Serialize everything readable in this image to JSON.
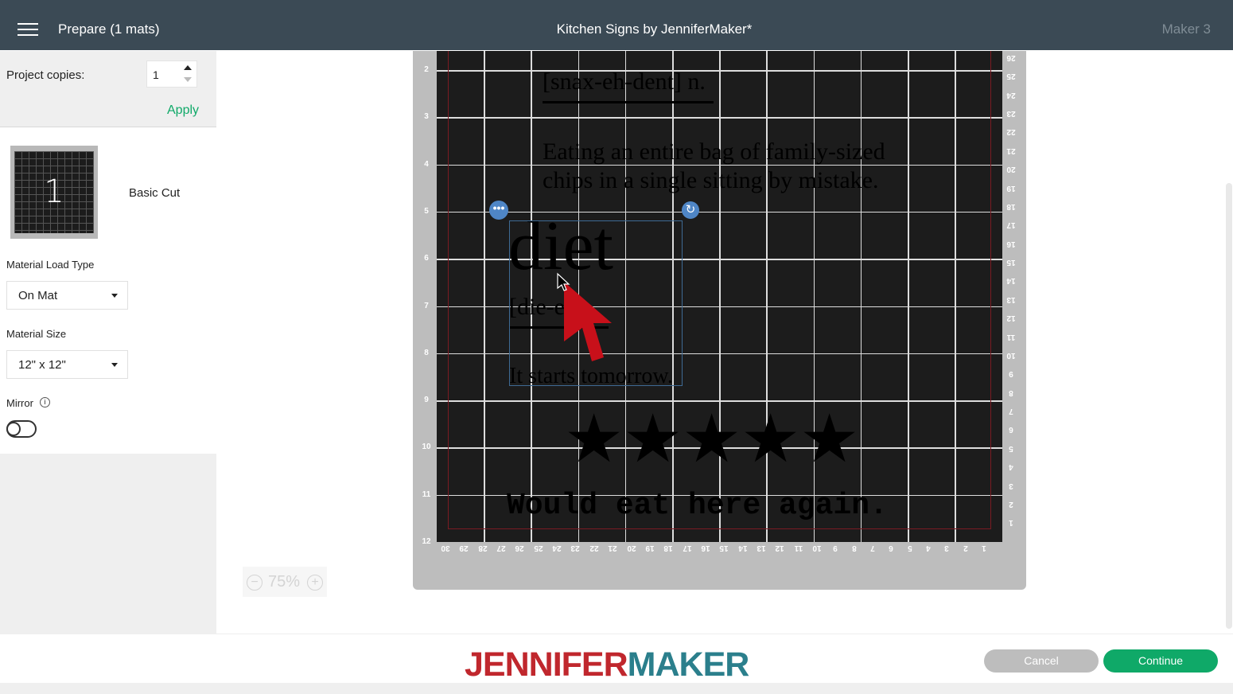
{
  "header": {
    "title": "Prepare (1 mats)",
    "project": "Kitchen Signs by JenniferMaker*",
    "machine": "Maker 3"
  },
  "sidebar": {
    "copies_label": "Project copies:",
    "copies_value": "1",
    "apply": "Apply",
    "mat_number": "1",
    "mat_name": "Basic Cut",
    "load_type_label": "Material Load Type",
    "load_type_value": "On Mat",
    "size_label": "Material Size",
    "size_value": "12\" x 12\"",
    "mirror_label": "Mirror",
    "mirror_on": false
  },
  "canvas": {
    "left_ruler": [
      "2",
      "3",
      "4",
      "5",
      "6",
      "7",
      "8",
      "9",
      "10",
      "11",
      "12"
    ],
    "right_ruler": [
      "26",
      "25",
      "24",
      "23",
      "22",
      "21",
      "20",
      "19",
      "18",
      "17",
      "16",
      "15",
      "14",
      "13",
      "12",
      "11",
      "10",
      "9",
      "8",
      "7",
      "6",
      "5",
      "4",
      "3",
      "2",
      "1"
    ],
    "bottom_ruler": [
      "30",
      "29",
      "28",
      "27",
      "26",
      "25",
      "24",
      "23",
      "22",
      "21",
      "20",
      "19",
      "18",
      "17",
      "16",
      "15",
      "14",
      "13",
      "12",
      "11",
      "10",
      "9",
      "8",
      "7",
      "6",
      "5",
      "4",
      "3",
      "2",
      "1"
    ],
    "design": {
      "pronunciation": "[snax-eh-dent] n.",
      "def_line1": "Eating an entire bag of family-sized",
      "def_line2": "chips in a single sitting by mistake.",
      "word": "diet",
      "word_pron": "[die-et]",
      "tagline": "It starts tomorrow.",
      "stars": 5,
      "footer_text": "Would eat here again."
    },
    "zoom": "75%"
  },
  "footer": {
    "logo_part1": "JENNIFER",
    "logo_part2": "MAKER",
    "cancel": "Cancel",
    "continue": "Continue"
  },
  "colors": {
    "accent": "#0fa968",
    "header": "#3b4a55",
    "logo_red": "#c0272d",
    "logo_teal": "#2b7f8c"
  }
}
